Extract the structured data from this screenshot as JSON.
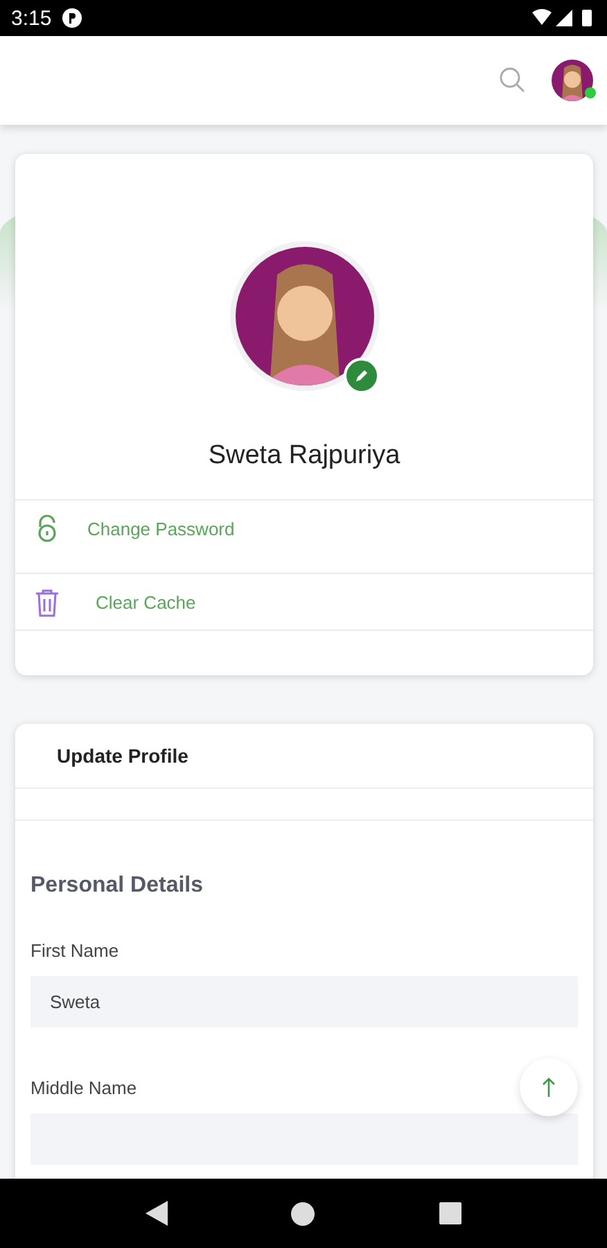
{
  "status_bar": {
    "time": "3:15"
  },
  "header": {
    "avatar_online": true
  },
  "profile": {
    "name": "Sweta Rajpuriya"
  },
  "menu": [
    {
      "kind": "lock",
      "label": "Change Password"
    },
    {
      "kind": "trash",
      "label": "Clear Cache"
    }
  ],
  "form": {
    "title": "Update Profile",
    "section": "Personal Details",
    "fields": [
      {
        "label": "First Name",
        "value": "Sweta"
      },
      {
        "label": "Middle Name"
      }
    ]
  }
}
